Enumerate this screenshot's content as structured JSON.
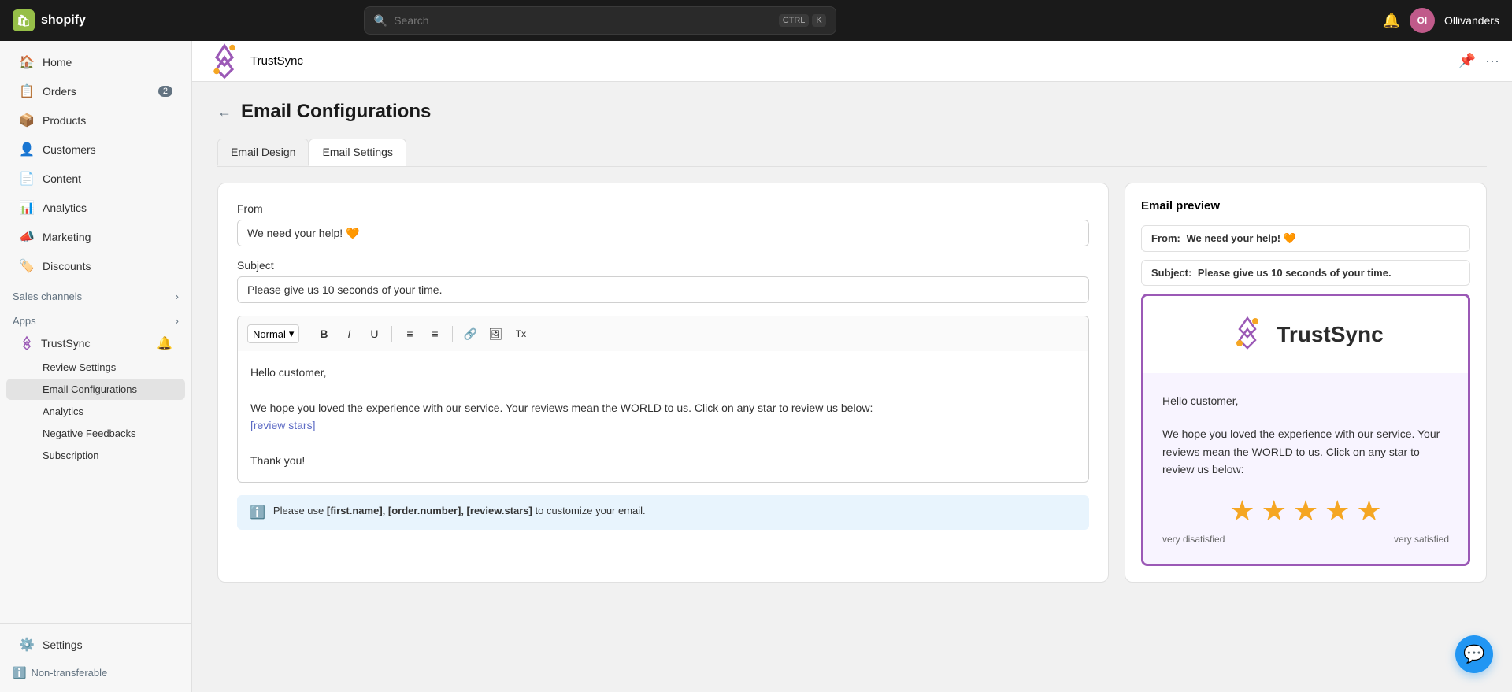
{
  "topNav": {
    "logoText": "shopify",
    "searchPlaceholder": "Search",
    "shortcutKey1": "CTRL",
    "shortcutKey2": "K",
    "bellIcon": "🔔",
    "avatarInitials": "Ol",
    "username": "Ollivanders"
  },
  "sidebar": {
    "navItems": [
      {
        "id": "home",
        "label": "Home",
        "icon": "🏠",
        "badge": null
      },
      {
        "id": "orders",
        "label": "Orders",
        "icon": "📋",
        "badge": "2"
      },
      {
        "id": "products",
        "label": "Products",
        "icon": "📦",
        "badge": null
      },
      {
        "id": "customers",
        "label": "Customers",
        "icon": "👤",
        "badge": null
      },
      {
        "id": "content",
        "label": "Content",
        "icon": "📄",
        "badge": null
      },
      {
        "id": "analytics",
        "label": "Analytics",
        "icon": "📊",
        "badge": null
      },
      {
        "id": "marketing",
        "label": "Marketing",
        "icon": "📣",
        "badge": null
      },
      {
        "id": "discounts",
        "label": "Discounts",
        "icon": "🏷️",
        "badge": null
      }
    ],
    "salesChannels": {
      "label": "Sales channels",
      "expandIcon": "›"
    },
    "apps": {
      "label": "Apps",
      "expandIcon": "›"
    },
    "appItems": [
      {
        "id": "trustsync",
        "label": "TrustSync"
      }
    ],
    "trustSyncSubItems": [
      {
        "id": "review-settings",
        "label": "Review Settings"
      },
      {
        "id": "email-configurations",
        "label": "Email Configurations",
        "active": true
      },
      {
        "id": "analytics",
        "label": "Analytics"
      },
      {
        "id": "negative-feedbacks",
        "label": "Negative Feedbacks"
      },
      {
        "id": "subscription",
        "label": "Subscription"
      }
    ],
    "bottomItems": [
      {
        "id": "settings",
        "label": "Settings",
        "icon": "⚙️"
      }
    ],
    "nonTransferable": "Non-transferable"
  },
  "appHeader": {
    "appName": "TrustSync",
    "pinIcon": "📌",
    "moreIcon": "···"
  },
  "page": {
    "backLabel": "←",
    "title": "Email Configurations",
    "tabs": [
      {
        "id": "email-design",
        "label": "Email Design",
        "active": true
      },
      {
        "id": "email-settings",
        "label": "Email Settings",
        "active": false
      }
    ]
  },
  "form": {
    "fromLabel": "From",
    "fromValue": "We need your help! 🧡",
    "subjectLabel": "Subject",
    "subjectValue": "Please give us 10 seconds of your time.",
    "toolbar": {
      "styleSelect": "Normal",
      "boldLabel": "B",
      "italicLabel": "I",
      "underlineLabel": "U",
      "olLabel": "≡",
      "ulLabel": "≡",
      "linkLabel": "🔗",
      "imageLabel": "🖼",
      "clearLabel": "Tx"
    },
    "bodyLines": [
      "Hello customer,",
      "",
      "We hope you loved the experience with our service. Your reviews mean the WORLD to us. Click on any star to review us below:",
      "[review stars]",
      "",
      "Thank you!"
    ],
    "bodyLink": "[review stars]",
    "infoBanner": {
      "icon": "ℹ️",
      "text": "Please use ",
      "highlights": "[first.name], [order.number], [review.stars]",
      "suffix": " to customize your email."
    }
  },
  "preview": {
    "title": "Email preview",
    "fromLabel": "From:",
    "fromValue": "We need your help! 🧡",
    "subjectLabel": "Subject:",
    "subjectValue": "Please give us 10 seconds of your time.",
    "logoText": "TrustSync",
    "emailBodyLine1": "Hello customer,",
    "emailBodyLine2": "We hope you loved the experience with our service. Your reviews mean the WORLD to us. Click on any star to review us below:",
    "stars": [
      "⭐",
      "⭐",
      "⭐",
      "⭐",
      "⭐"
    ],
    "labelLeft": "very disatisfied",
    "labelRight": "very satisfied"
  }
}
